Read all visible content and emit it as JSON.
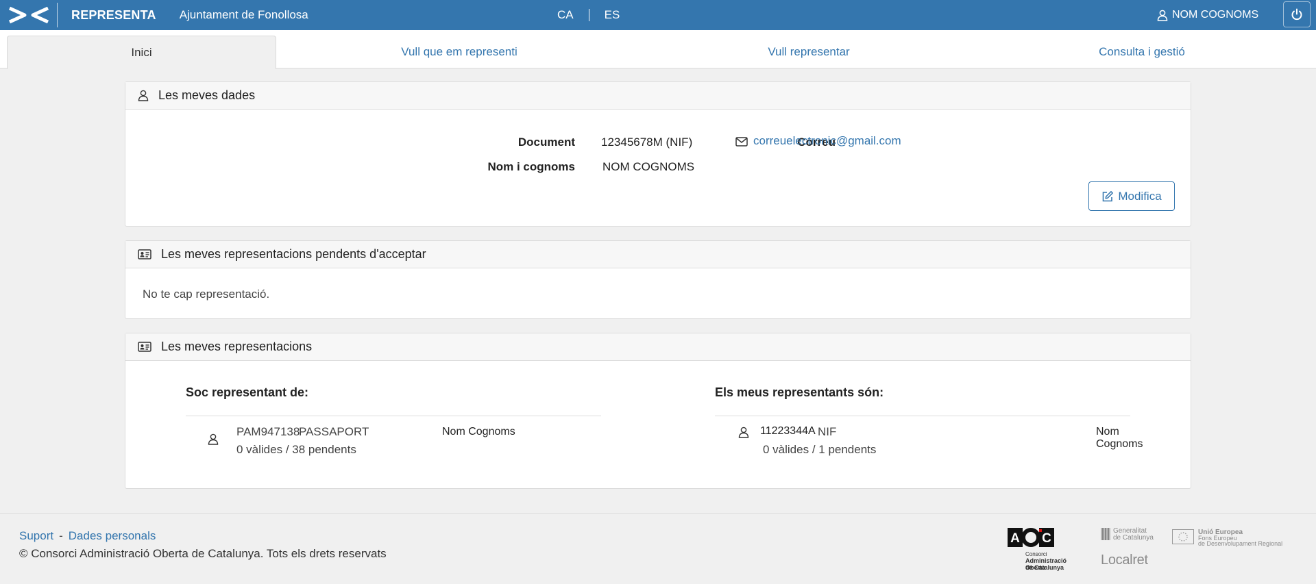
{
  "header": {
    "brand": "REPRESENTA",
    "organization": "Ajuntament de Fonollosa",
    "languages": [
      "CA",
      "ES"
    ],
    "user_name": "NOM COGNOMS"
  },
  "tabs": [
    {
      "label": "Inici",
      "active": true
    },
    {
      "label": "Vull que em representi",
      "active": false
    },
    {
      "label": "Vull representar",
      "active": false
    },
    {
      "label": "Consulta i gestió",
      "active": false
    }
  ],
  "my_data": {
    "title": "Les meves dades",
    "document_label": "Document",
    "document_value": "12345678M (NIF)",
    "name_label": "Nom i cognoms",
    "name_value": "NOM COGNOMS",
    "email_label": "Correu",
    "email_value": "correuelectronic@gmail.com",
    "edit_button": "Modifica"
  },
  "pending": {
    "title": "Les meves representacions pendents d'acceptar",
    "empty_text": "No te cap representació."
  },
  "representations": {
    "title": "Les meves representacions",
    "represented_heading": "Soc representant de:",
    "represented": {
      "id": "PAM947138",
      "doc_type": "PASSAPORT",
      "name": "Nom Cognoms",
      "counts": "0 vàlides / 38 pendents"
    },
    "representatives_heading": "Els meus representants són:",
    "representative": {
      "id": "11223344A",
      "doc_type": "NIF",
      "name": "Nom Cognoms",
      "counts": "0 vàlides / 1 pendents"
    }
  },
  "footer": {
    "links": [
      "Suport",
      "Dades personals"
    ],
    "copyright": "© Consorci Administració Oberta de Catalunya. Tots els drets reservats",
    "logos": {
      "aoc_sub": [
        "Consorci",
        "Administració Oberta",
        "de Catalunya"
      ],
      "generalitat": [
        "Generalitat",
        "de Catalunya"
      ],
      "localret": "Localret",
      "ue": [
        "Unió Europea",
        "Fons Europeu",
        "de Desenvolupament Regional"
      ]
    }
  },
  "colors": {
    "primary": "#3476ae",
    "background": "#f0f0f0"
  }
}
